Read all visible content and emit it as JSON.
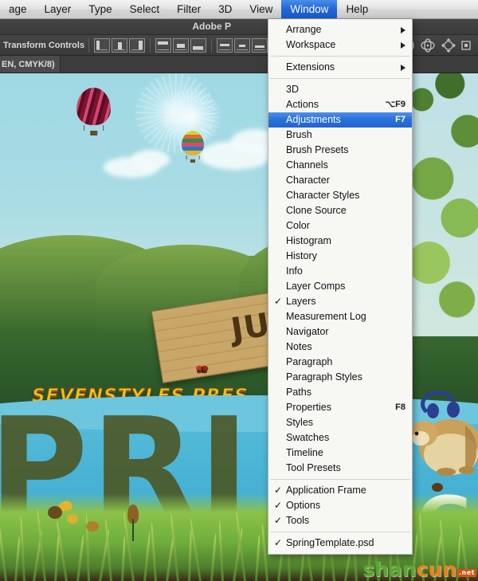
{
  "menubar": {
    "items": [
      {
        "label": "age",
        "name": "menubar-item-image",
        "active": false
      },
      {
        "label": "Layer",
        "name": "menubar-item-layer",
        "active": false
      },
      {
        "label": "Type",
        "name": "menubar-item-type",
        "active": false
      },
      {
        "label": "Select",
        "name": "menubar-item-select",
        "active": false
      },
      {
        "label": "Filter",
        "name": "menubar-item-filter",
        "active": false
      },
      {
        "label": "3D",
        "name": "menubar-item-3d",
        "active": false
      },
      {
        "label": "View",
        "name": "menubar-item-view",
        "active": false
      },
      {
        "label": "Window",
        "name": "menubar-item-window",
        "active": true
      },
      {
        "label": "Help",
        "name": "menubar-item-help",
        "active": false
      }
    ]
  },
  "titlebar": {
    "app_title": "Adobe P"
  },
  "optionsbar": {
    "transform_controls_label": "Transform Controls"
  },
  "tabbar": {
    "document_tab_label": "EN, CMYK/8)"
  },
  "artwork": {
    "tagline": "SEVENSTYLES PRES",
    "big_letters": "PRI",
    "sign_text": "JU",
    "blob_letter": "G",
    "watermark": {
      "part1": "shan",
      "part2": "cun",
      "part3": ".net"
    }
  },
  "window_menu": {
    "title": "Window",
    "items": [
      {
        "label": "Arrange",
        "submenu": true,
        "check": false,
        "key": "",
        "selected": false
      },
      {
        "label": "Workspace",
        "submenu": true,
        "check": false,
        "key": "",
        "selected": false
      },
      {
        "separator": true
      },
      {
        "label": "Extensions",
        "submenu": true,
        "check": false,
        "key": "",
        "selected": false
      },
      {
        "separator": true
      },
      {
        "label": "3D",
        "submenu": false,
        "check": false,
        "key": "",
        "selected": false
      },
      {
        "label": "Actions",
        "submenu": false,
        "check": false,
        "key": "⌥F9",
        "selected": false
      },
      {
        "label": "Adjustments",
        "submenu": false,
        "check": false,
        "key": "F7",
        "selected": true
      },
      {
        "label": "Brush",
        "submenu": false,
        "check": false,
        "key": "",
        "selected": false
      },
      {
        "label": "Brush Presets",
        "submenu": false,
        "check": false,
        "key": "",
        "selected": false
      },
      {
        "label": "Channels",
        "submenu": false,
        "check": false,
        "key": "",
        "selected": false
      },
      {
        "label": "Character",
        "submenu": false,
        "check": false,
        "key": "",
        "selected": false
      },
      {
        "label": "Character Styles",
        "submenu": false,
        "check": false,
        "key": "",
        "selected": false
      },
      {
        "label": "Clone Source",
        "submenu": false,
        "check": false,
        "key": "",
        "selected": false
      },
      {
        "label": "Color",
        "submenu": false,
        "check": false,
        "key": "",
        "selected": false
      },
      {
        "label": "Histogram",
        "submenu": false,
        "check": false,
        "key": "",
        "selected": false
      },
      {
        "label": "History",
        "submenu": false,
        "check": false,
        "key": "",
        "selected": false
      },
      {
        "label": "Info",
        "submenu": false,
        "check": false,
        "key": "",
        "selected": false
      },
      {
        "label": "Layer Comps",
        "submenu": false,
        "check": false,
        "key": "",
        "selected": false
      },
      {
        "label": "Layers",
        "submenu": false,
        "check": true,
        "key": "",
        "selected": false
      },
      {
        "label": "Measurement Log",
        "submenu": false,
        "check": false,
        "key": "",
        "selected": false
      },
      {
        "label": "Navigator",
        "submenu": false,
        "check": false,
        "key": "",
        "selected": false
      },
      {
        "label": "Notes",
        "submenu": false,
        "check": false,
        "key": "",
        "selected": false
      },
      {
        "label": "Paragraph",
        "submenu": false,
        "check": false,
        "key": "",
        "selected": false
      },
      {
        "label": "Paragraph Styles",
        "submenu": false,
        "check": false,
        "key": "",
        "selected": false
      },
      {
        "label": "Paths",
        "submenu": false,
        "check": false,
        "key": "",
        "selected": false
      },
      {
        "label": "Properties",
        "submenu": false,
        "check": false,
        "key": "F8",
        "selected": false
      },
      {
        "label": "Styles",
        "submenu": false,
        "check": false,
        "key": "",
        "selected": false
      },
      {
        "label": "Swatches",
        "submenu": false,
        "check": false,
        "key": "",
        "selected": false
      },
      {
        "label": "Timeline",
        "submenu": false,
        "check": false,
        "key": "",
        "selected": false
      },
      {
        "label": "Tool Presets",
        "submenu": false,
        "check": false,
        "key": "",
        "selected": false
      },
      {
        "separator": true
      },
      {
        "label": "Application Frame",
        "submenu": false,
        "check": true,
        "key": "",
        "selected": false
      },
      {
        "label": "Options",
        "submenu": false,
        "check": true,
        "key": "",
        "selected": false
      },
      {
        "label": "Tools",
        "submenu": false,
        "check": true,
        "key": "",
        "selected": false
      },
      {
        "separator": true
      },
      {
        "label": "SpringTemplate.psd",
        "submenu": false,
        "check": true,
        "key": "",
        "selected": false
      }
    ]
  },
  "colors": {
    "menu_highlight": "#2166cf",
    "menu_bg": "#f7f7f4",
    "chrome_bg": "#3c3c3c",
    "tagline_gold": "#f0c319",
    "sky_blue": "#a8dbe4",
    "water_blue": "#49b2d4",
    "grass_green": "#8cc24a"
  }
}
